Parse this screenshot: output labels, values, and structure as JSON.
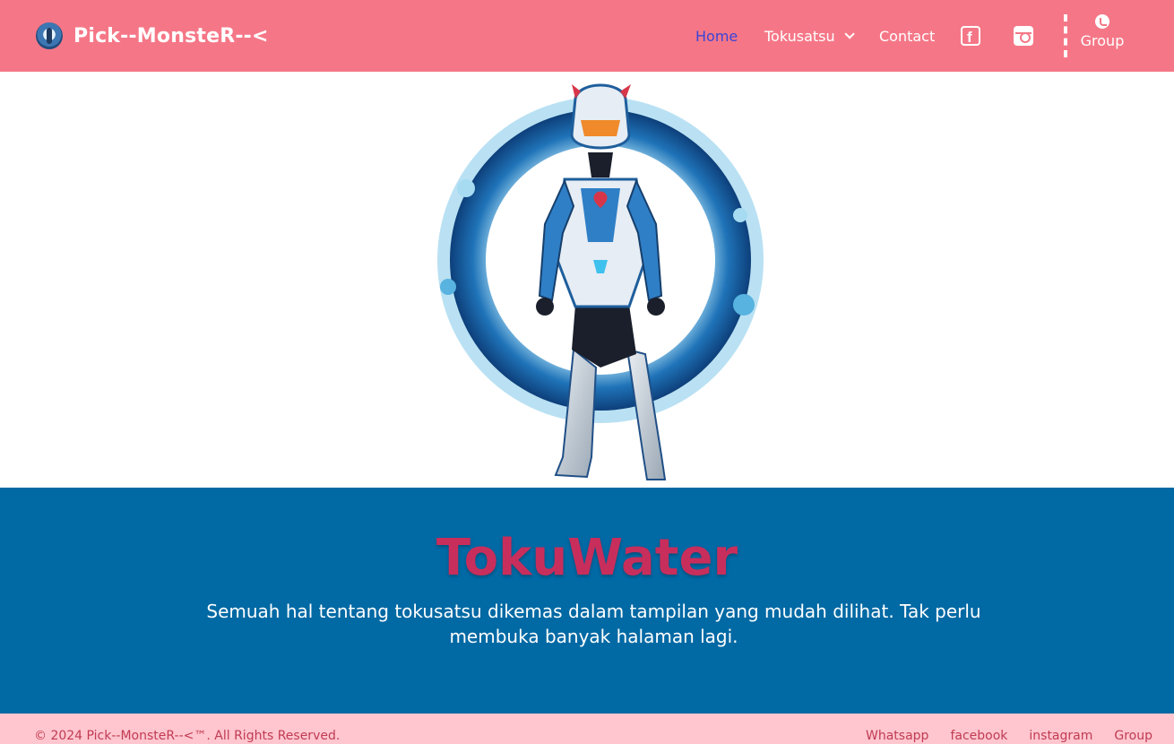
{
  "header": {
    "brand_name": "Pick--MonsteR--<",
    "nav": {
      "home": "Home",
      "tokusatsu": "Tokusatsu",
      "contact": "Contact",
      "group": "Group"
    }
  },
  "banner": {
    "title": "TokuWater",
    "description": "Semuah hal tentang tokusatsu dikemas dalam tampilan yang mudah dilihat. Tak perlu membuka banyak halaman lagi."
  },
  "footer": {
    "copyright": "© 2024 Pick--MonsteR--<™. All Rights Reserved.",
    "links": [
      "Whatsapp",
      "facebook",
      "instagram",
      "Group"
    ]
  },
  "colors": {
    "header_bg": "#f57787",
    "active_link": "#3b44d6",
    "banner_bg": "#0169a4",
    "banner_title": "#c82e5c",
    "footer_bg": "#ffc6cf",
    "footer_text": "#c03b52"
  },
  "icons": [
    "brand-logo",
    "chevron-down-icon",
    "facebook-icon",
    "instagram-icon",
    "whatsapp-icon"
  ]
}
